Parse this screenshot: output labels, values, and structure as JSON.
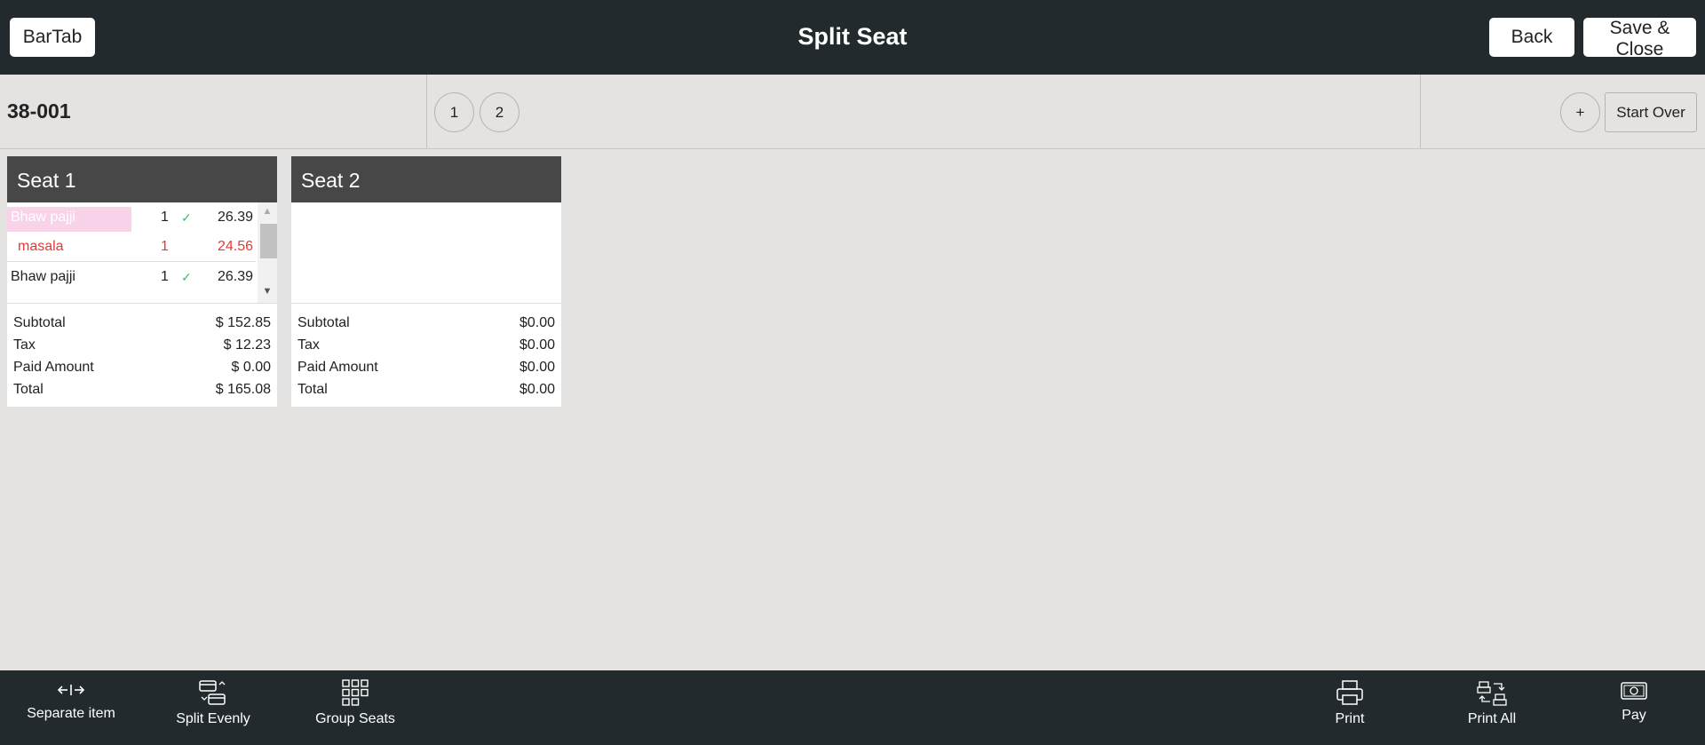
{
  "header": {
    "left_button": "BarTab",
    "title": "Split Seat",
    "back_button": "Back",
    "save_button": "Save & Close"
  },
  "info": {
    "order_number": "38-001",
    "seat_tabs": [
      "1",
      "2"
    ],
    "add_button": "+",
    "start_over_button": "Start Over"
  },
  "seats": [
    {
      "title": "Seat 1",
      "items": [
        {
          "name": "Bhaw pajji",
          "qty": "1",
          "price": "26.39",
          "status": "check-icon"
        },
        {
          "name": "masala",
          "qty": "1",
          "price": "24.56",
          "status": ""
        },
        {
          "name": "Bhaw pajji",
          "qty": "1",
          "price": "26.39",
          "status": "check-icon"
        }
      ],
      "totals": [
        {
          "label": "Subtotal",
          "value": "$ 152.85"
        },
        {
          "label": "Tax",
          "value": "$ 12.23"
        },
        {
          "label": "Paid Amount",
          "value": "$ 0.00"
        },
        {
          "label": "Total",
          "value": "$ 165.08"
        }
      ]
    },
    {
      "title": "Seat 2",
      "items": [],
      "totals": [
        {
          "label": "Subtotal",
          "value": "$0.00"
        },
        {
          "label": "Tax",
          "value": "$0.00"
        },
        {
          "label": "Paid Amount",
          "value": "$0.00"
        },
        {
          "label": "Total",
          "value": "$0.00"
        }
      ]
    }
  ],
  "footer": {
    "actions": [
      {
        "label": "Separate item",
        "icon": "separate-arrows-icon"
      },
      {
        "label": "Split Evenly",
        "icon": "split-evenly-icon"
      },
      {
        "label": "Group Seats",
        "icon": "grid-icon"
      },
      {
        "label": "Print",
        "icon": "printer-icon"
      },
      {
        "label": "Print All",
        "icon": "print-all-icon"
      },
      {
        "label": "Pay",
        "icon": "cash-icon"
      }
    ]
  },
  "colors": {
    "bar_background": "#232a2d",
    "page_background": "#e5e3e1",
    "seat_header": "#474747",
    "modifier_red": "#e53935",
    "check_green": "#3ac26c",
    "selected_item_highlight": "#f9d3e9"
  }
}
